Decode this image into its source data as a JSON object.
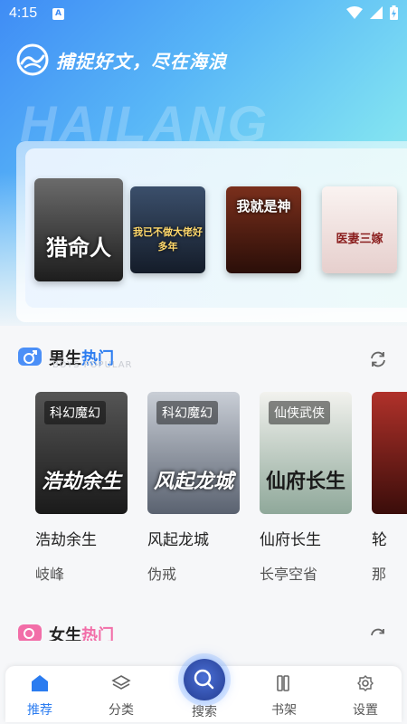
{
  "status_bar": {
    "time": "4:15",
    "notification_icon": "A"
  },
  "header": {
    "slogan": "捕捉好文，尽在海浪",
    "watermark": "HAILANG"
  },
  "banner": {
    "covers": [
      {
        "title": "猎命人",
        "palette": "#3a3a3a"
      },
      {
        "title": "我已不做大佬好多年",
        "palette": "#1f2b3d"
      },
      {
        "title": "我就是神",
        "palette": "#4a1e14"
      },
      {
        "title": "医妻三嫁",
        "palette": "#f1e6e4"
      }
    ]
  },
  "boys_section": {
    "title_a": "男生",
    "title_b": "热门",
    "subtitle": "BOYS POPULAR",
    "books": [
      {
        "tag": "科幻魔幻",
        "cover_text": "浩劫余生",
        "title": "浩劫余生",
        "author": "岐峰"
      },
      {
        "tag": "科幻魔幻",
        "cover_text": "风起龙城",
        "title": "风起龙城",
        "author": "伪戒"
      },
      {
        "tag": "仙侠武侠",
        "cover_text": "仙府长生",
        "title": "仙府长生",
        "author": "长亭空省"
      },
      {
        "tag": "",
        "cover_text": "",
        "title": "轮",
        "author": "那"
      }
    ]
  },
  "girls_section": {
    "title_a": "女生",
    "title_b": "热门"
  },
  "bottom_nav": {
    "items": [
      {
        "label": "推荐",
        "icon": "home-icon",
        "active": true
      },
      {
        "label": "分类",
        "icon": "layers-icon",
        "active": false
      },
      {
        "label": "搜索",
        "icon": "search-icon",
        "active": false
      },
      {
        "label": "书架",
        "icon": "bookshelf-icon",
        "active": false
      },
      {
        "label": "设置",
        "icon": "gear-icon",
        "active": false
      }
    ]
  },
  "colors": {
    "accent": "#2b7cf0",
    "hero_start": "#3f8cf5",
    "hero_end": "#aef2ea"
  }
}
